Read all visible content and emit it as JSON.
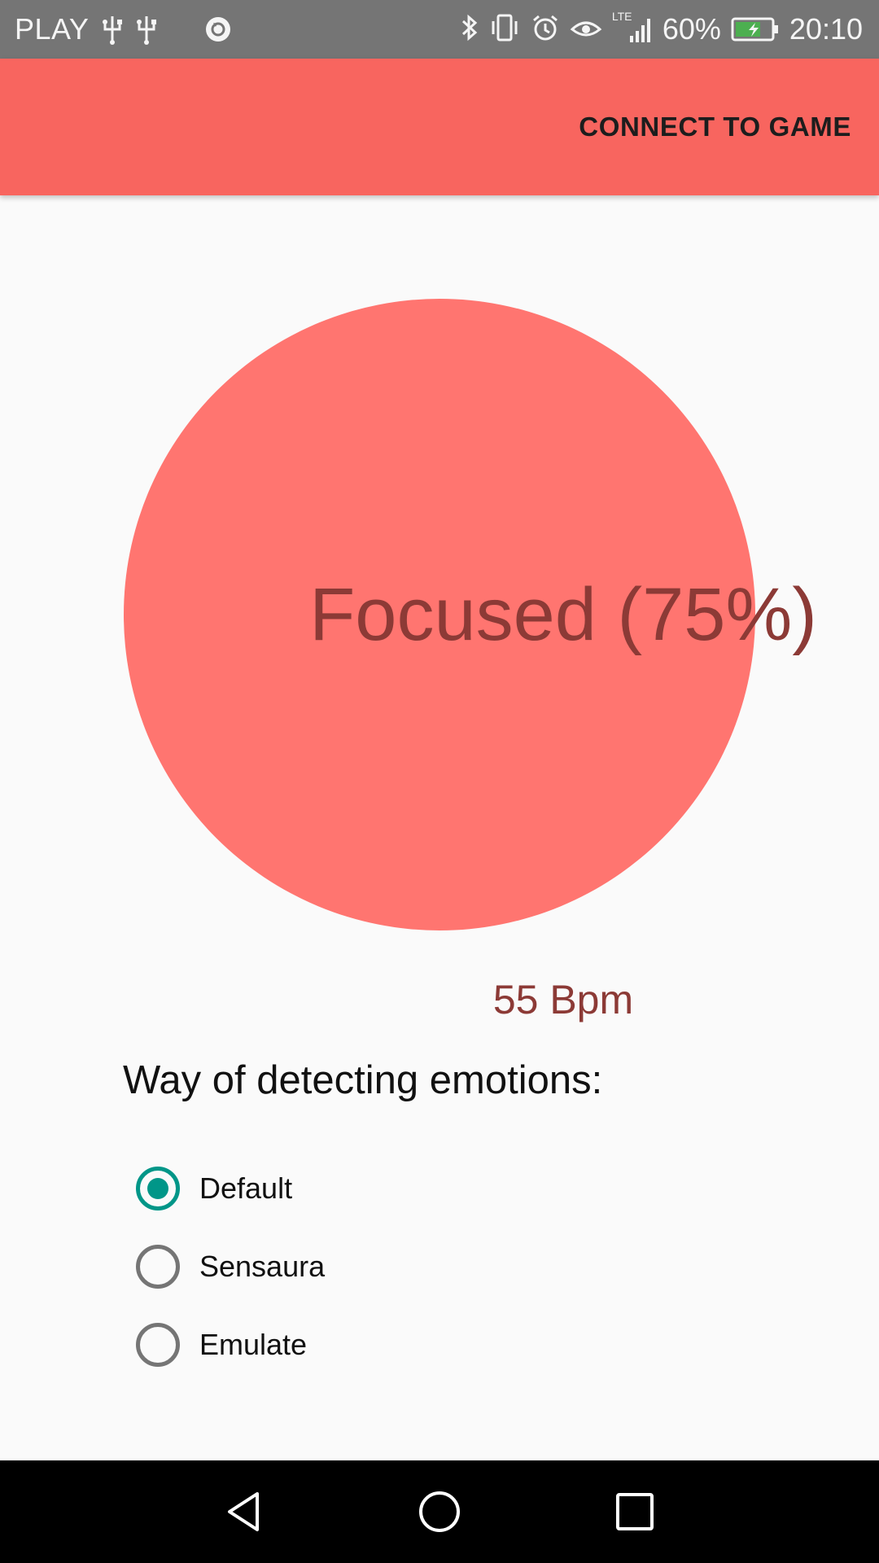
{
  "status_bar": {
    "carrier": "PLAY",
    "network": "LTE",
    "battery": "60%",
    "time": "20:10"
  },
  "app_bar": {
    "action_label": "CONNECT TO GAME"
  },
  "emotion": {
    "state_label": "Focused (75%)",
    "heart_rate": "55 Bpm",
    "circle_color": "#ff7570"
  },
  "detection": {
    "heading": "Way of detecting emotions:",
    "options": [
      {
        "label": "Default",
        "selected": true
      },
      {
        "label": "Sensaura",
        "selected": false
      },
      {
        "label": "Emulate",
        "selected": false
      }
    ]
  },
  "colors": {
    "app_bar": "#f8655f",
    "accent": "#009688",
    "status_bar": "#757575"
  }
}
